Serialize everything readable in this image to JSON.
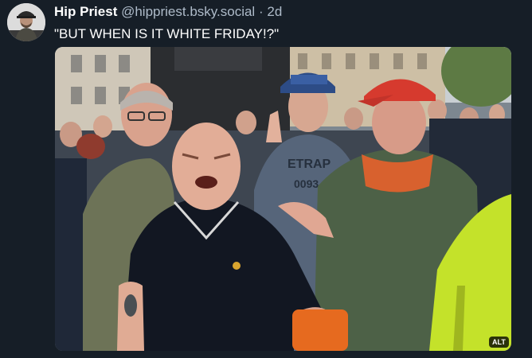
{
  "post": {
    "author": {
      "display_name": "Hip Priest",
      "handle": "@hippriest.bsky.social",
      "separator": "·",
      "age": "2d"
    },
    "text": "\"BUT WHEN IS IT WHITE FRIDAY!?\"",
    "media": {
      "alt_badge": "ALT",
      "shirt_lettering": [
        "ETRAP",
        "0093"
      ]
    }
  },
  "colors": {
    "background": "#161e27",
    "secondary_text": "#aebbc9",
    "primary_text": "#ffffff"
  }
}
